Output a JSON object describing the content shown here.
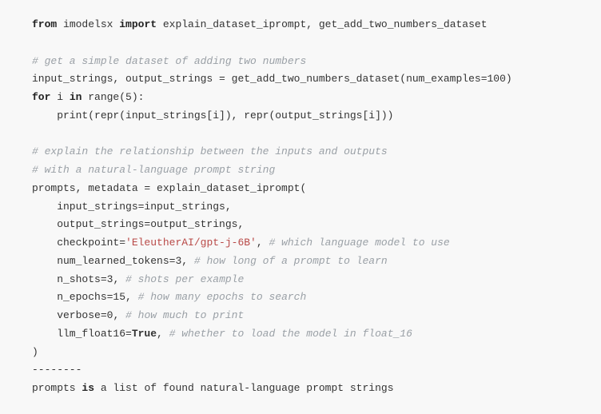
{
  "code": {
    "l1": {
      "kw1": "from",
      "mod": " imodelsx ",
      "kw2": "import",
      "rest": " explain_dataset_iprompt, get_add_two_numbers_dataset"
    },
    "l2": "",
    "l3": "# get a simple dataset of adding two numbers",
    "l4": {
      "a": "input_strings, output_strings = get_add_two_numbers_dataset(num_examples=",
      "n": "100",
      "b": ")"
    },
    "l5": {
      "kw1": "for",
      "a": " i ",
      "kw2": "in",
      "b": " range(",
      "n": "5",
      "c": "):"
    },
    "l6": "    print(repr(input_strings[i]), repr(output_strings[i]))",
    "l7": "",
    "l8": "# explain the relationship between the inputs and outputs",
    "l9": "# with a natural-language prompt string",
    "l10": "prompts, metadata = explain_dataset_iprompt(",
    "l11": "    input_strings=input_strings,",
    "l12": "    output_strings=output_strings,",
    "l13": {
      "a": "    checkpoint=",
      "s": "'EleutherAI/gpt-j-6B'",
      "b": ", ",
      "c": "# which language model to use"
    },
    "l14": {
      "a": "    num_learned_tokens=",
      "n": "3",
      "b": ", ",
      "c": "# how long of a prompt to learn"
    },
    "l15": {
      "a": "    n_shots=",
      "n": "3",
      "b": ", ",
      "c": "# shots per example"
    },
    "l16": {
      "a": "    n_epochs=",
      "n": "15",
      "b": ", ",
      "c": "# how many epochs to search"
    },
    "l17": {
      "a": "    verbose=",
      "n": "0",
      "b": ", ",
      "c": "# how much to print"
    },
    "l18": {
      "a": "    llm_float16=",
      "t": "True",
      "b": ", ",
      "c": "# whether to load the model in float_16"
    },
    "l19": ")",
    "l20": "--------",
    "l21": {
      "a": "prompts ",
      "kw": "is",
      "b": " a list of found natural-language prompt strings"
    }
  }
}
